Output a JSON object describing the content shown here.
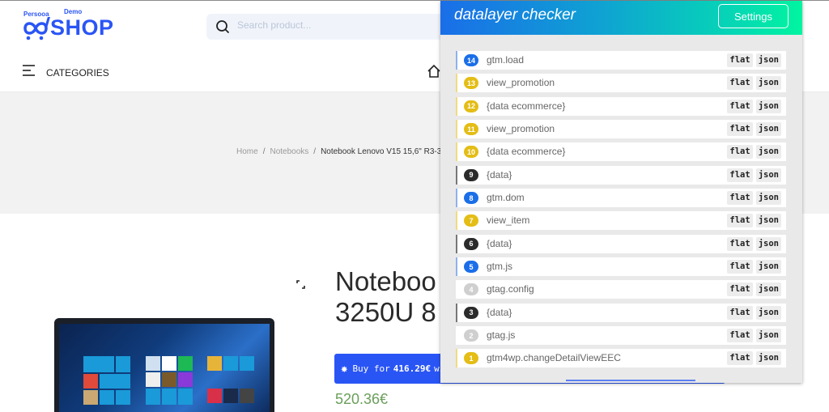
{
  "shop": {
    "logo": {
      "small_left": "Persooa",
      "small_right": "Demo",
      "brand": "SHOP"
    },
    "search": {
      "placeholder": "Search product..."
    },
    "categories_label": "CATEGORIES",
    "breadcrumb": [
      {
        "label": "Home"
      },
      {
        "label": "Notebooks"
      },
      {
        "label": "Notebook Lenovo V15 15,6\" R3-3"
      }
    ],
    "breadcrumb_sep": "/",
    "product": {
      "title_line1": "Noteboo",
      "title_line2": "3250U 8",
      "buy_prefix": "Buy for",
      "buy_price": "416.29€",
      "buy_suffix": "wit",
      "price": "520.36€"
    }
  },
  "extension": {
    "title": "datalayer checker",
    "settings_label": "Settings",
    "flat_label": "flat",
    "json_label": "json",
    "colors": {
      "blue": "#1a6ee8",
      "yellow": "#e4bd15",
      "black": "#2b2b2b",
      "grey": "#cfcfcf"
    },
    "events": [
      {
        "num": "14",
        "name": "gtm.load",
        "color": "blue"
      },
      {
        "num": "13",
        "name": "view_promotion",
        "color": "yellow"
      },
      {
        "num": "12",
        "name": "{data ecommerce}",
        "color": "yellow"
      },
      {
        "num": "11",
        "name": "view_promotion",
        "color": "yellow"
      },
      {
        "num": "10",
        "name": "{data ecommerce}",
        "color": "yellow"
      },
      {
        "num": "9",
        "name": "{data}",
        "color": "black"
      },
      {
        "num": "8",
        "name": "gtm.dom",
        "color": "blue"
      },
      {
        "num": "7",
        "name": "view_item",
        "color": "yellow"
      },
      {
        "num": "6",
        "name": "{data}",
        "color": "black"
      },
      {
        "num": "5",
        "name": "gtm.js",
        "color": "blue"
      },
      {
        "num": "4",
        "name": "gtag.config",
        "color": "grey"
      },
      {
        "num": "3",
        "name": "{data}",
        "color": "black"
      },
      {
        "num": "2",
        "name": "gtag.js",
        "color": "grey"
      },
      {
        "num": "1",
        "name": "gtm4wp.changeDetailViewEEC",
        "color": "yellow"
      }
    ]
  }
}
